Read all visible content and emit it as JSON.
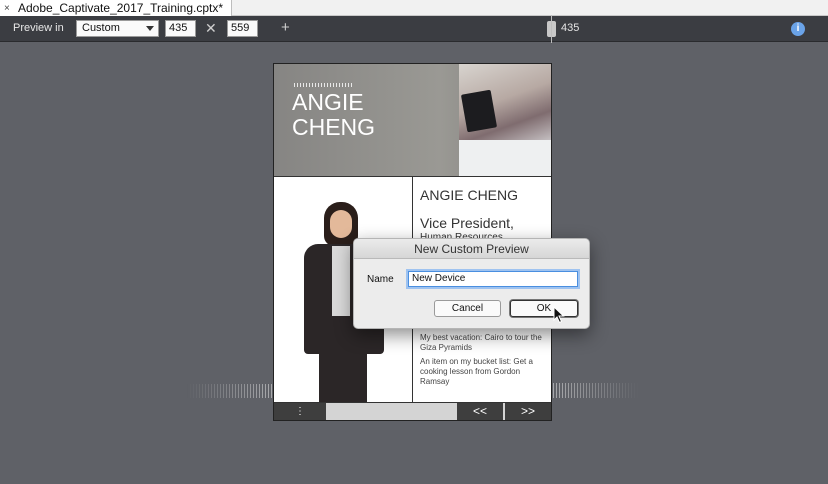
{
  "tab": {
    "close_glyph": "×",
    "title": "Adobe_Captivate_2017_Training.cptx*"
  },
  "toolbar": {
    "preview_label": "Preview in",
    "preset_value": "Custom",
    "width_value": "435",
    "height_value": "559",
    "times_glyph": "✕",
    "add_glyph": "+",
    "slider_value": "435",
    "info_glyph": "i"
  },
  "slide": {
    "hero_name": "ANGIE CHENG",
    "name": "ANGIE CHENG",
    "title_line1": "Vice President,",
    "title_line2": "Human Resources",
    "fact1": "My best vacation: Cairo to tour the Giza Pyramids",
    "fact2": "An item on my bucket list: Get a cooking lesson from Gordon Ramsay",
    "menu_glyph": "⋮",
    "prev_label": "<<",
    "next_label": ">>"
  },
  "dialog": {
    "title": "New Custom Preview",
    "name_label": "Name",
    "name_value": "New Device",
    "cancel_label": "Cancel",
    "ok_label": "OK"
  },
  "colors": {
    "accent": "#4a8fe0",
    "info": "#6aa3e8",
    "toolbar": "#3b3d42",
    "stage": "#5f6167"
  }
}
